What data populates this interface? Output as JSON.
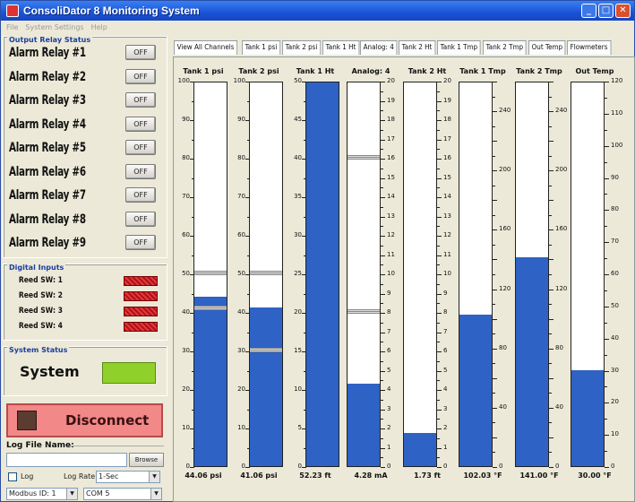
{
  "window": {
    "title": "ConsoliDator 8 Monitoring System"
  },
  "menu": [
    "File",
    "System Settings",
    "Help"
  ],
  "relays": {
    "section_title": "Output Relay Status",
    "items": [
      {
        "label": "Alarm Relay #1",
        "state": "OFF"
      },
      {
        "label": "Alarm Relay #2",
        "state": "OFF"
      },
      {
        "label": "Alarm Relay #3",
        "state": "OFF"
      },
      {
        "label": "Alarm Relay #4",
        "state": "OFF"
      },
      {
        "label": "Alarm Relay #5",
        "state": "OFF"
      },
      {
        "label": "Alarm Relay #6",
        "state": "OFF"
      },
      {
        "label": "Alarm Relay #7",
        "state": "OFF"
      },
      {
        "label": "Alarm Relay #8",
        "state": "OFF"
      },
      {
        "label": "Alarm Relay #9",
        "state": "OFF"
      }
    ]
  },
  "digital_inputs": {
    "section_title": "Digital Inputs",
    "items": [
      {
        "label": "Reed SW: 1"
      },
      {
        "label": "Reed SW: 2"
      },
      {
        "label": "Reed SW: 3"
      },
      {
        "label": "Reed SW: 4"
      }
    ]
  },
  "system_status": {
    "section_title": "System Status",
    "label": "System",
    "color": "#8fd12a"
  },
  "connection": {
    "button_label": "Disconnect"
  },
  "log": {
    "title": "Log File Name:",
    "filename": "",
    "browse_label": "Browse",
    "log_checkbox_label": "Log",
    "rate_label": "Log Rate:",
    "rate_value": "1-Sec",
    "modbus_value": "Modbus ID: 1",
    "com_value": "COM 5"
  },
  "tabs": [
    "View All Channels",
    "Tank 1 psi",
    "Tank 2 psi",
    "Tank 1 Ht",
    "Analog: 4",
    "Tank 2 Ht",
    "Tank 1 Tmp",
    "Tank 2 Tmp",
    "Out Temp",
    "Flowmeters"
  ],
  "active_tab": 0,
  "colors": {
    "fill": "#2e62c4",
    "led_alarm": "#c81e24",
    "disconnect": "#f28888"
  },
  "channels": [
    {
      "name": "Tank 1 psi",
      "min": 0,
      "max": 100,
      "step": 10,
      "value": 44.06,
      "display": "44.06 psi",
      "markers": [
        50,
        41
      ],
      "scale_side": "left"
    },
    {
      "name": "Tank 2 psi",
      "min": 0,
      "max": 100,
      "step": 10,
      "value": 41.06,
      "display": "41.06 psi",
      "markers": [
        50,
        30
      ],
      "scale_side": "left"
    },
    {
      "name": "Tank 1 Ht",
      "min": 0,
      "max": 50,
      "step": 5,
      "value": 52.23,
      "display": "52.23 ft",
      "markers": [],
      "scale_side": "left"
    },
    {
      "name": "Analog: 4",
      "min": 0,
      "max": 20,
      "step": 1,
      "value": 4.28,
      "display": "4.28 mA",
      "markers": [
        16,
        8
      ],
      "scale_side": "right"
    },
    {
      "name": "Tank 2 Ht",
      "min": 0,
      "max": 20,
      "step": 1,
      "value": 1.73,
      "display": "1.73 ft",
      "markers": [],
      "scale_side": "right"
    },
    {
      "name": "Tank 1 Tmp",
      "min": 0,
      "max": 260,
      "step": 20,
      "value": 102.03,
      "display": "102.03 °F",
      "markers": [],
      "scale_side": "right"
    },
    {
      "name": "Tank 2 Tmp",
      "min": 0,
      "max": 260,
      "step": 20,
      "value": 141.0,
      "display": "141.00 °F",
      "markers": [],
      "scale_side": "right"
    },
    {
      "name": "Out Temp",
      "min": 0,
      "max": 120,
      "step": 10,
      "value": 30.0,
      "display": "30.00 °F",
      "markers": [],
      "scale_side": "right"
    }
  ]
}
